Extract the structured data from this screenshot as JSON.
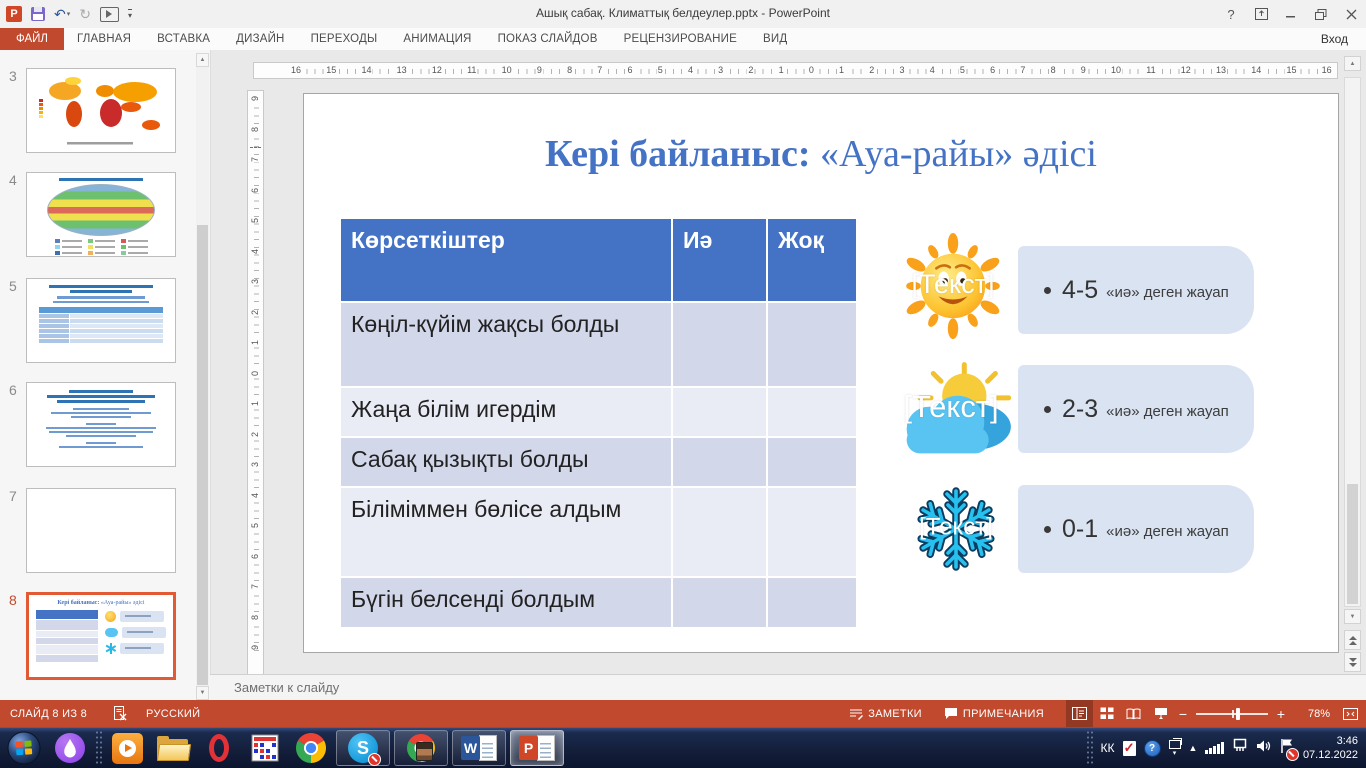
{
  "titlebar": {
    "title": "Ашық сабақ. Климаттық белдеулер.pptx - PowerPoint",
    "sign_in": "Вход"
  },
  "ribbon": {
    "file_tab": "ФАЙЛ",
    "tabs": [
      "ГЛАВНАЯ",
      "ВСТАВКА",
      "ДИЗАЙН",
      "ПЕРЕХОДЫ",
      "АНИМАЦИЯ",
      "ПОКАЗ СЛАЙДОВ",
      "РЕЦЕНЗИРОВАНИЕ",
      "ВИД"
    ]
  },
  "thumbnail_panel": {
    "slides": [
      {
        "number": "3",
        "kind": "world-heat-map"
      },
      {
        "number": "4",
        "kind": "climate-zones-map"
      },
      {
        "number": "5",
        "kind": "text-with-table"
      },
      {
        "number": "6",
        "kind": "text-paragraphs"
      },
      {
        "number": "7",
        "kind": "blank"
      },
      {
        "number": "8",
        "kind": "current-slide",
        "selected": true
      }
    ]
  },
  "rulers": {
    "horizontal": [
      16,
      15,
      14,
      13,
      12,
      11,
      10,
      9,
      8,
      7,
      6,
      5,
      4,
      3,
      2,
      1,
      0,
      1,
      2,
      3,
      4,
      5,
      6,
      7,
      8,
      9,
      10,
      11,
      12,
      13,
      14,
      15,
      16
    ],
    "vertical": [
      9,
      8,
      7,
      6,
      5,
      4,
      3,
      2,
      1,
      0,
      1,
      2,
      3,
      4,
      5,
      6,
      7,
      8,
      9
    ]
  },
  "slide": {
    "title": {
      "bold": "Кері байланыс:",
      "regular": " «Ауа-райы» әдісі"
    },
    "table": {
      "headers": [
        "Көрсеткіштер",
        "Иә",
        "Жоқ"
      ],
      "rows": [
        "Көңіл-күйім жақсы болды",
        "Жаңа білім игердім",
        "Сабақ қызықты болды",
        "Біліміммен бөлісе алдым",
        "Бүгін белсенді болдым"
      ]
    },
    "legend": [
      {
        "icon": "sun-icon",
        "overlay": "[Текст]",
        "value": "4-5",
        "caption": "«иә» деген жауап"
      },
      {
        "icon": "sun-behind-cloud-icon",
        "overlay": "[Текст]",
        "value": "2-3",
        "caption": "«иә» деген жауап"
      },
      {
        "icon": "snowflake-icon",
        "overlay": "[Текст]",
        "value": "0-1",
        "caption": "«иә» деген жауап"
      }
    ]
  },
  "notes_panel": {
    "placeholder": "Заметки к слайду"
  },
  "status_bar": {
    "slide_counter": "СЛАЙД 8 ИЗ 8",
    "language": "РУССКИЙ",
    "notes": "ЗАМЕТКИ",
    "comments": "ПРИМЕЧАНИЯ",
    "zoom_level": "78%"
  },
  "taskbar": {
    "apps": [
      "start",
      "assistant",
      "media-player",
      "file-explorer",
      "opera",
      "grid-planner",
      "chrome",
      "skype",
      "chrome-profile",
      "word",
      "powerpoint"
    ],
    "glyphs": {
      "skype": "S",
      "word": "W",
      "powerpoint": "P"
    },
    "language_indicator": "КК",
    "time": "3:46",
    "date": "07.12.2022"
  },
  "icons": {
    "help": "?",
    "undo": "↶",
    "redo": "↻",
    "caret_down": "▾",
    "up_arrow": "▲",
    "down_arrow": "▼",
    "minus": "−",
    "plus": "+",
    "check": "✓"
  },
  "colors": {
    "accent": "#C14A2E",
    "selection": "#E25A33",
    "table_header": "#4472C4",
    "title_blue": "#4472C4",
    "band_dark": "#D2D7EA",
    "band_light": "#E9EBF5",
    "legend_box": "#DAE3F2"
  }
}
